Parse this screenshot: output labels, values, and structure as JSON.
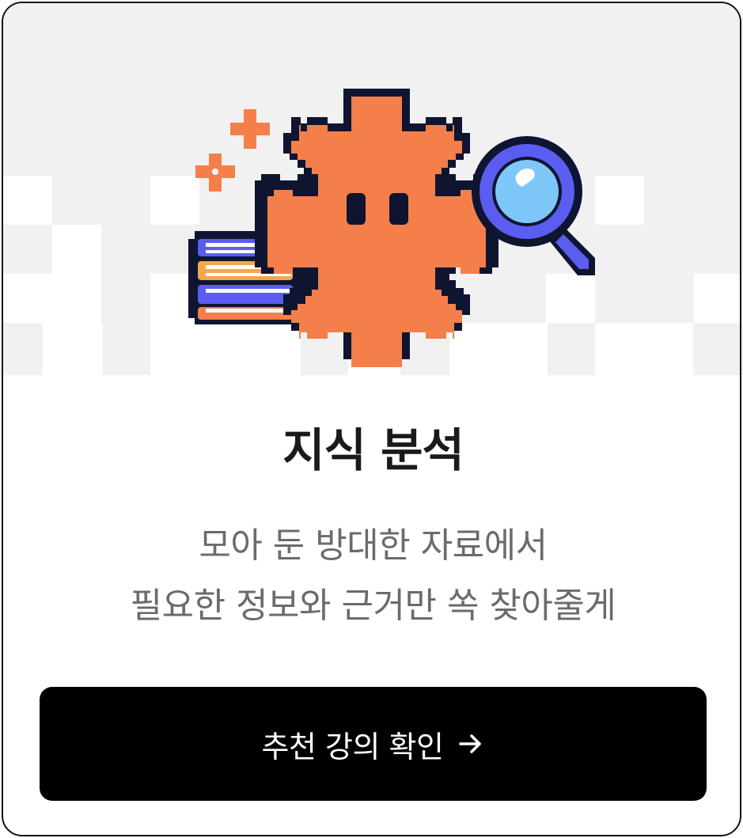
{
  "card": {
    "title": "지식 분석",
    "description_lines": [
      "모아 둔 방대한 자료에서",
      "필요한 정보와 근거만 쏙 찾아줄게"
    ],
    "cta_label": "추천 강의 확인",
    "cta_icon": "arrow-right-icon"
  },
  "illustration": {
    "icons": [
      "sparkle-plus-icon",
      "books-stack-icon",
      "asterisk-mascot-icon",
      "magnifier-icon"
    ]
  },
  "colors": {
    "hero_background": "#f1f1f1",
    "checker_light": "#ffffff",
    "mascot_orange": "#f47f4a",
    "outline_dark": "#0f1530",
    "magnifier_blue": "#5b5cf0",
    "lens_blue": "#7ec7f8",
    "title_text": "#1a1a1a",
    "body_text": "#6b6b6b",
    "button_bg": "#000000",
    "button_text": "#ffffff"
  }
}
